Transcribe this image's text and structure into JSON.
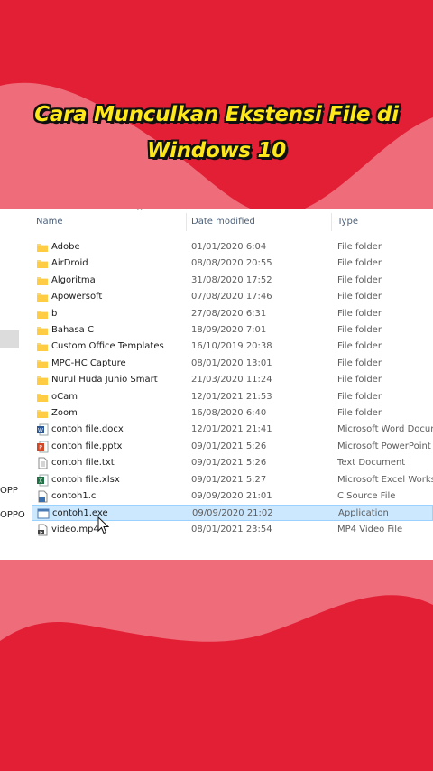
{
  "overlay": {
    "title_line1": "Cara Munculkan Ekstensi File di",
    "title_line2": "Windows 10",
    "title_color": "#ffe81a",
    "bg_color": "#e21f35",
    "wave_color": "#ef6c7a"
  },
  "explorer": {
    "columns": {
      "name": "Name",
      "date": "Date modified",
      "type": "Type"
    },
    "nav_pane": [
      "OPP",
      "OPPO"
    ],
    "files": [
      {
        "name": "Adobe",
        "date": "01/01/2020 6:04",
        "type": "File folder",
        "icon": "folder-icon"
      },
      {
        "name": "AirDroid",
        "date": "08/08/2020 20:55",
        "type": "File folder",
        "icon": "folder-icon"
      },
      {
        "name": "Algoritma",
        "date": "31/08/2020 17:52",
        "type": "File folder",
        "icon": "folder-icon"
      },
      {
        "name": "Apowersoft",
        "date": "07/08/2020 17:46",
        "type": "File folder",
        "icon": "folder-icon"
      },
      {
        "name": "b",
        "date": "27/08/2020 6:31",
        "type": "File folder",
        "icon": "folder-icon"
      },
      {
        "name": "Bahasa C",
        "date": "18/09/2020 7:01",
        "type": "File folder",
        "icon": "folder-icon"
      },
      {
        "name": "Custom Office Templates",
        "date": "16/10/2019 20:38",
        "type": "File folder",
        "icon": "folder-icon"
      },
      {
        "name": "MPC-HC Capture",
        "date": "08/01/2020 13:01",
        "type": "File folder",
        "icon": "folder-icon"
      },
      {
        "name": "Nurul Huda Junio Smart",
        "date": "21/03/2020 11:24",
        "type": "File folder",
        "icon": "folder-icon"
      },
      {
        "name": "oCam",
        "date": "12/01/2021 21:53",
        "type": "File folder",
        "icon": "folder-icon"
      },
      {
        "name": "Zoom",
        "date": "16/08/2020 6:40",
        "type": "File folder",
        "icon": "folder-icon"
      },
      {
        "name": "contoh file.docx",
        "date": "12/01/2021 21:41",
        "type": "Microsoft Word Docum",
        "icon": "word-icon"
      },
      {
        "name": "contoh file.pptx",
        "date": "09/01/2021 5:26",
        "type": "Microsoft PowerPoint P",
        "icon": "powerpoint-icon"
      },
      {
        "name": "contoh file.txt",
        "date": "09/01/2021 5:26",
        "type": "Text Document",
        "icon": "text-file-icon"
      },
      {
        "name": "contoh file.xlsx",
        "date": "09/01/2021 5:27",
        "type": "Microsoft Excel Worksh",
        "icon": "excel-icon"
      },
      {
        "name": "contoh1.c",
        "date": "09/09/2020 21:01",
        "type": "C Source File",
        "icon": "c-source-icon"
      },
      {
        "name": "contoh1.exe",
        "date": "09/09/2020 21:02",
        "type": "Application",
        "icon": "application-icon",
        "selected": true
      },
      {
        "name": "video.mp4",
        "date": "08/01/2021 23:54",
        "type": "MP4 Video File",
        "icon": "video-file-icon"
      }
    ]
  }
}
